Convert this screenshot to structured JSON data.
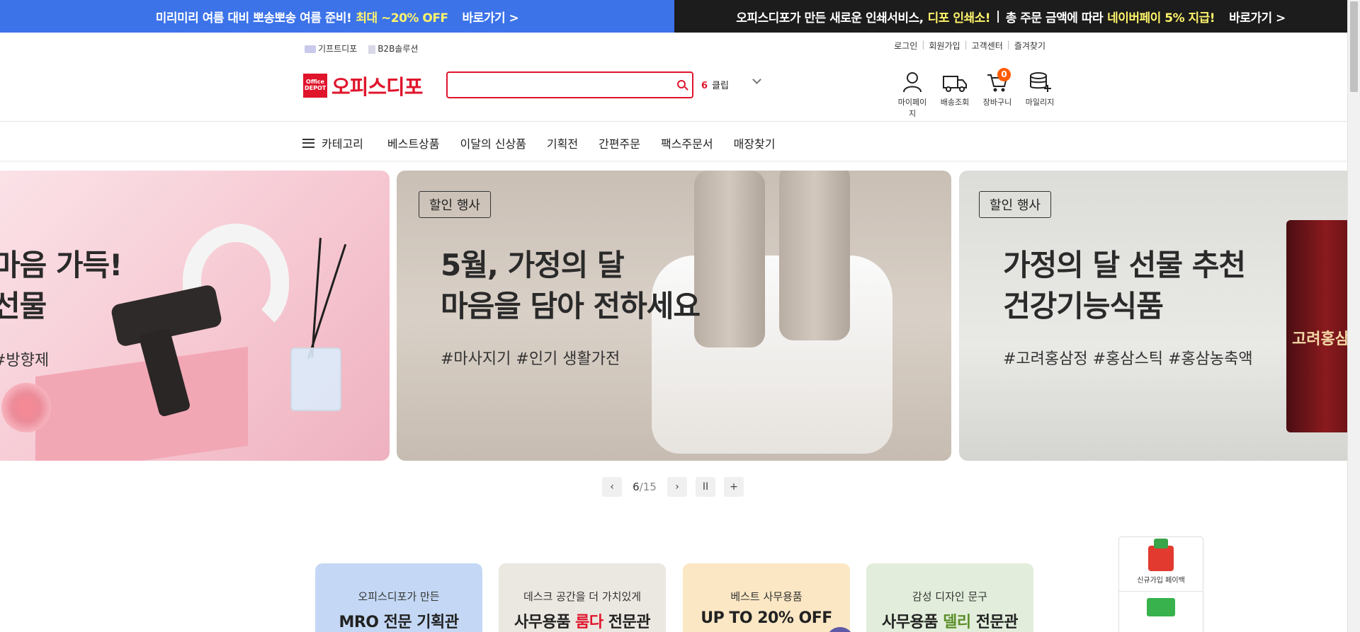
{
  "promo_left": {
    "text": "미리미리 여름 대비 뽀송뽀송 여름 준비!",
    "highlight": "최대 ~20% OFF",
    "go": "바로가기 >"
  },
  "promo_right": {
    "text1": "오피스디포가 만든 새로운 인쇄서비스,",
    "highlight1": "디포 인쇄소!",
    "sep": "|",
    "text2": "총 주문 금액에 따라",
    "highlight2": "네이버페이 5% 지급!",
    "go": "바로가기 >"
  },
  "header": {
    "util_left": [
      "기프트디포",
      "B2B솔루션"
    ],
    "util_right": [
      "로그인",
      "회원가입",
      "고객센터",
      "즐겨찾기"
    ],
    "logo_box": "Office DEPOT",
    "logo_text": "오피스디포",
    "search_placeholder": "",
    "keyword_rank": "6",
    "keyword": "클립",
    "icons": [
      {
        "label": "마이페이지",
        "icon": "user-icon"
      },
      {
        "label": "배송조회",
        "icon": "truck-icon"
      },
      {
        "label": "장바구니",
        "icon": "cart-icon",
        "badge": "0"
      },
      {
        "label": "마일리지",
        "icon": "coins-icon"
      }
    ]
  },
  "nav": {
    "category": "카테고리",
    "items": [
      "베스트상품",
      "이달의 신상품",
      "기획전",
      "간편주문",
      "팩스주문서",
      "매장찾기"
    ]
  },
  "banners": [
    {
      "tag": "",
      "line1": "마음 가득!",
      "line2": "선물",
      "hash": "#방향제"
    },
    {
      "tag": "할인 행사",
      "line1": "5월, 가정의 달",
      "line2": "마음을 담아 전하세요",
      "hash": "#마사지기 #인기 생활가전"
    },
    {
      "tag": "할인 행사",
      "line1": "가정의 달 선물 추천",
      "line2": "건강기능식품",
      "hash": "#고려홍삼정 #홍삼스틱 #홍삼농축액",
      "product_label": "고려홍삼"
    }
  ],
  "carousel": {
    "current": "6",
    "total": "/15",
    "prev": "‹",
    "next": "›",
    "pause": "II",
    "more": "+"
  },
  "cards": [
    {
      "sub": "오피스디포가 만든",
      "main_a": "MRO 전문 기획관",
      "main_hl": "",
      "main_b": ""
    },
    {
      "sub": "데스크 공간을 더 가치있게",
      "main_a": "사무용품 ",
      "main_hl": "룸다",
      "main_b": " 전문관"
    },
    {
      "sub": "베스트 사무용품",
      "main_a": "UP TO 20% OFF",
      "main_hl": "",
      "main_b": ""
    },
    {
      "sub": "감성 디자인 문구",
      "main_a": "사무용품 ",
      "main_hl": "델리",
      "main_b": " 전문관"
    }
  ],
  "sidebox": {
    "label": "신규가입 페이백"
  },
  "colors": {
    "brand_red": "#e0152c",
    "promo_blue": "#3c73e9",
    "promo_dark": "#1c1c1c",
    "highlight_yellow": "#fff46b",
    "badge_orange": "#ff5a00"
  }
}
